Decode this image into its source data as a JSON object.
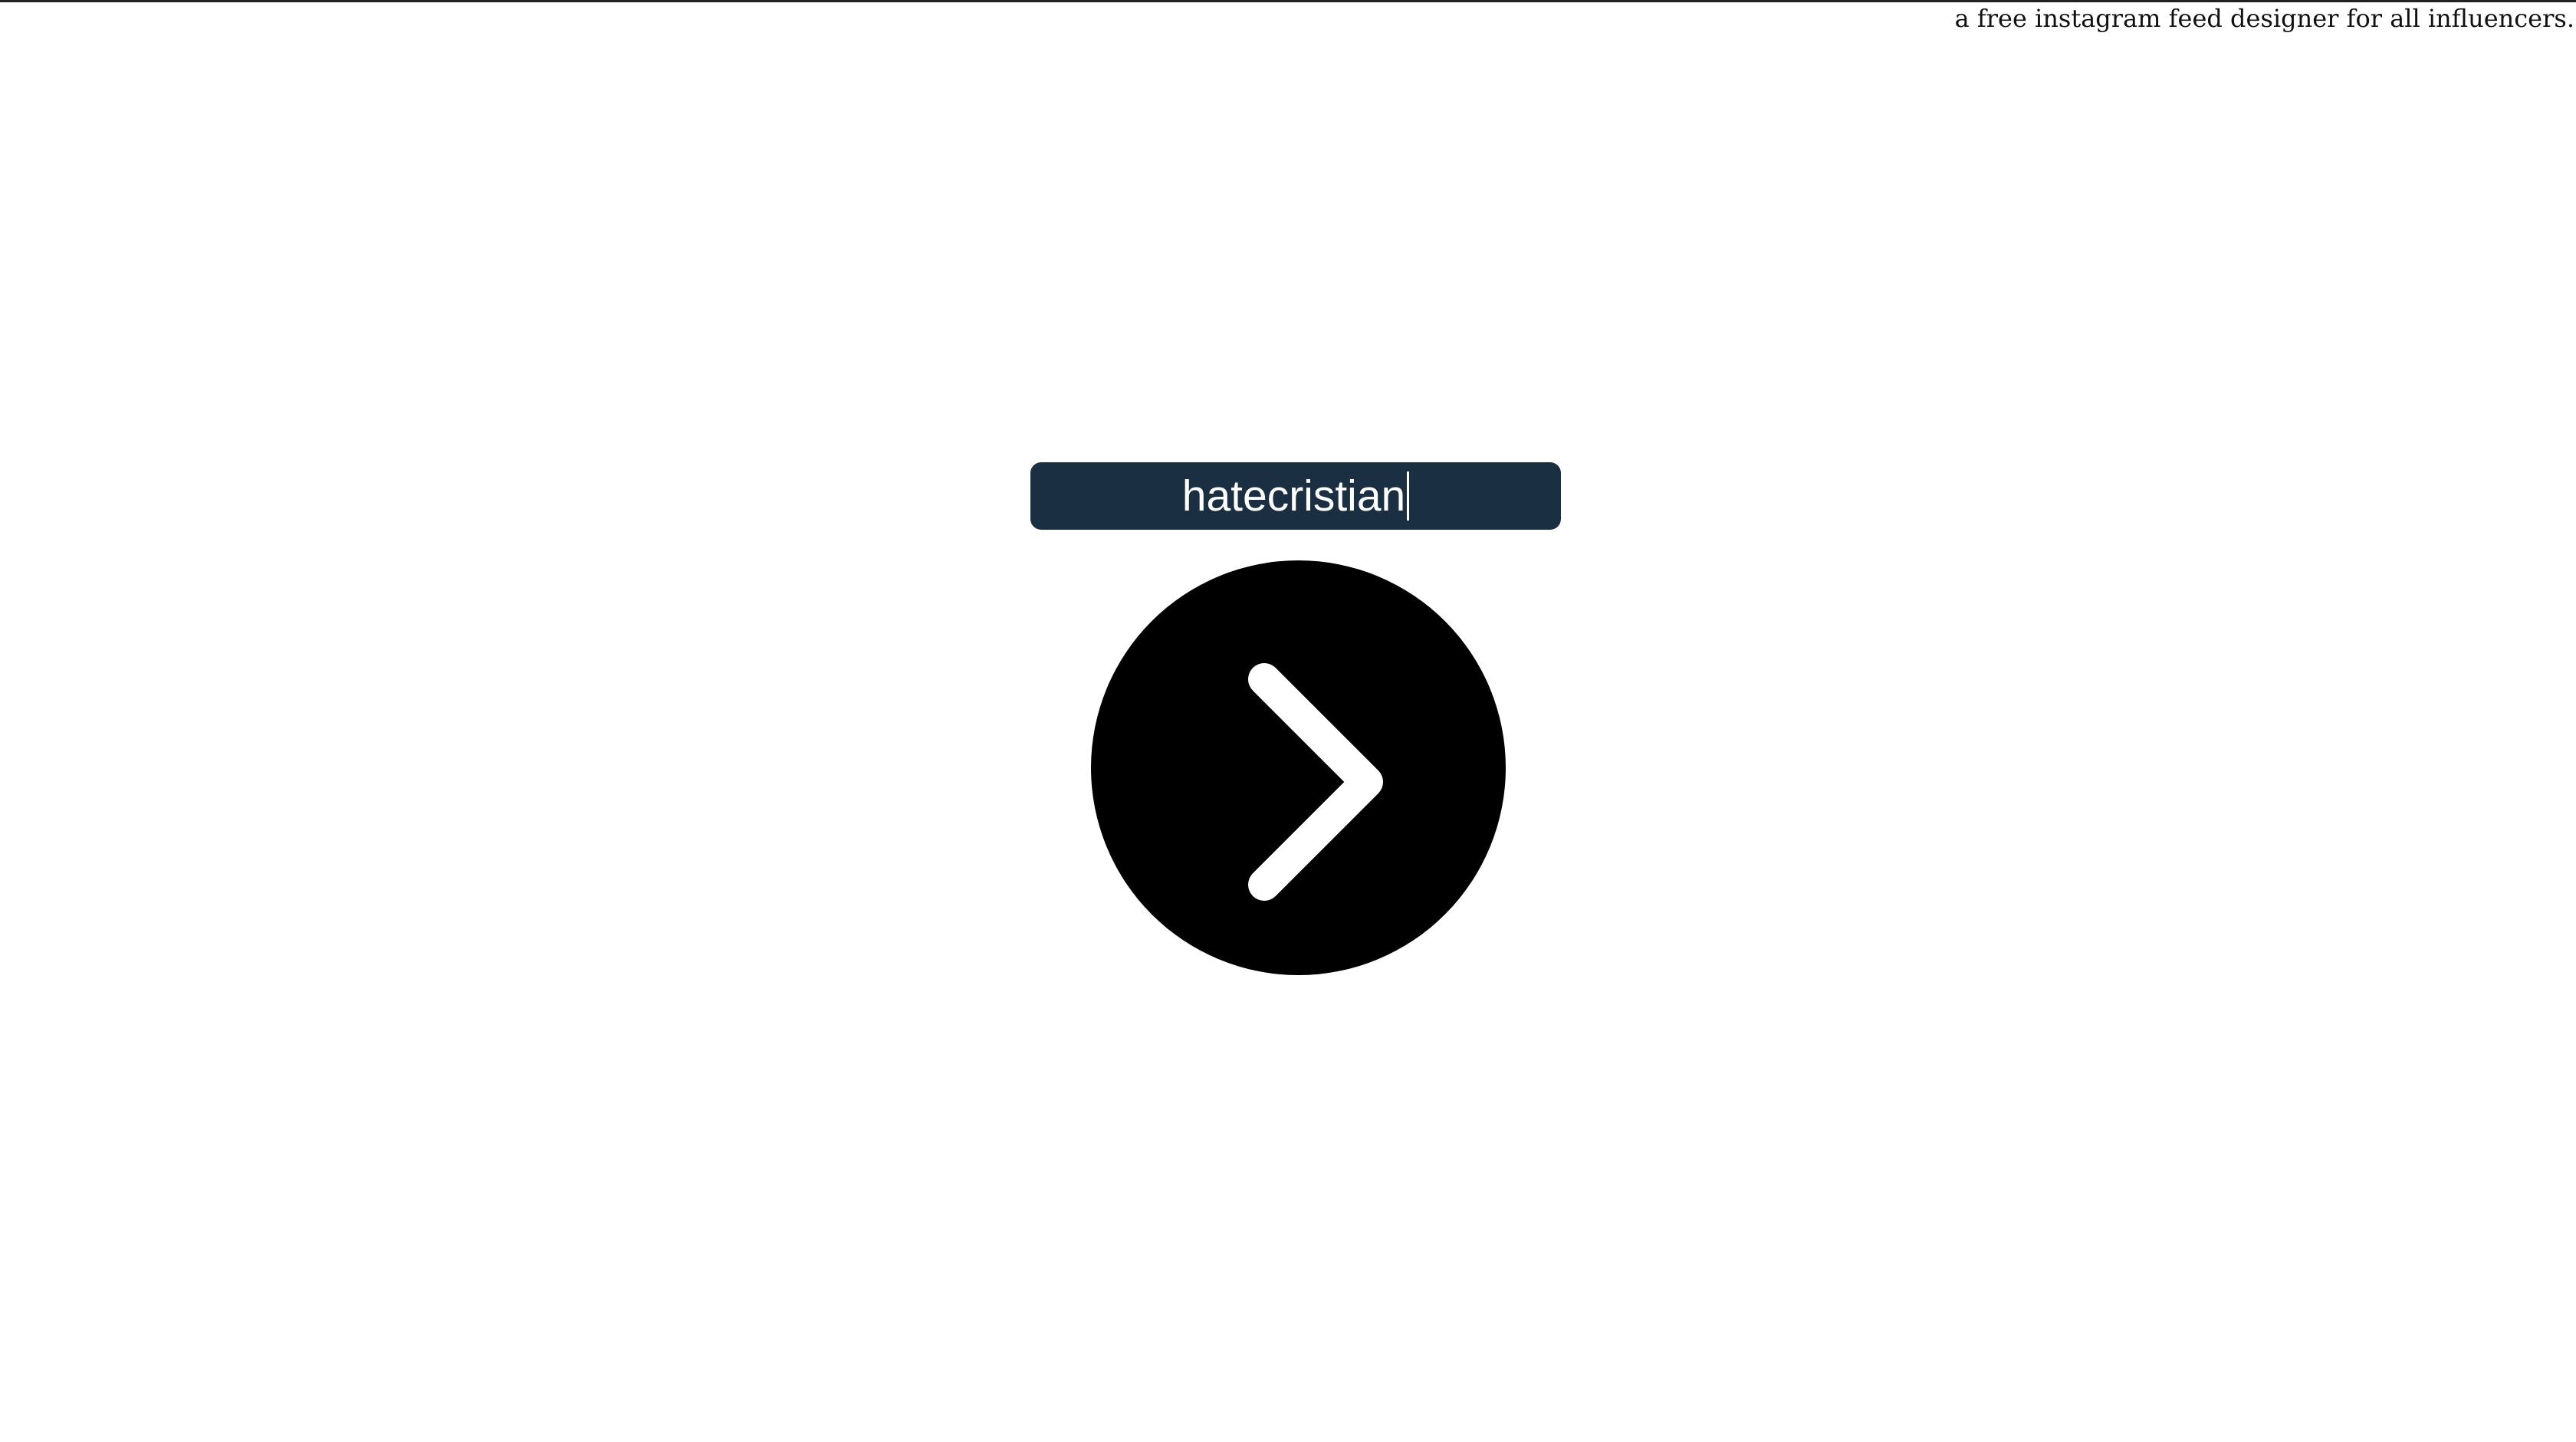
{
  "header": {
    "tagline": "a free instagram feed designer for all influencers."
  },
  "username_input": {
    "value": "hatecristian",
    "background_color": "#1a3042",
    "text_color": "#ffffff"
  },
  "go_button": {
    "icon": "chevron-right-icon",
    "background_color": "#000000",
    "icon_color": "#ffffff"
  }
}
